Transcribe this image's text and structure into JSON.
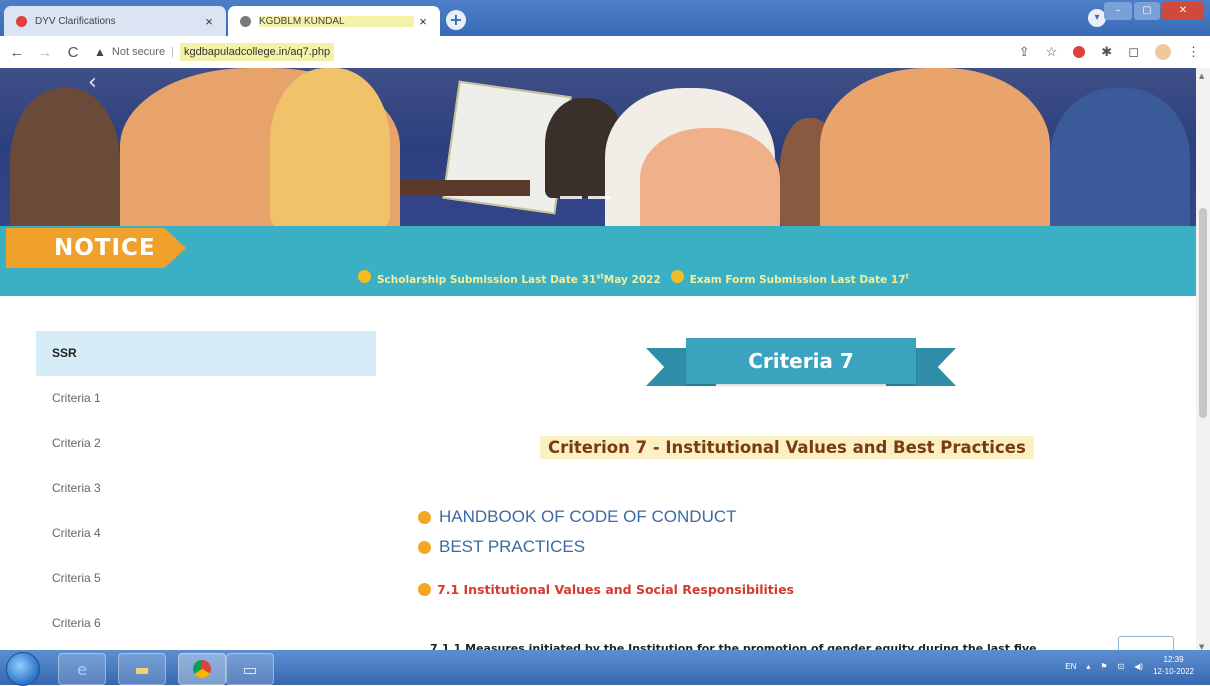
{
  "browser": {
    "tabs": [
      {
        "title": "DYV Clarifications",
        "close": "×"
      },
      {
        "title": "KGDBLM KUNDAL",
        "close": "×"
      }
    ],
    "new_tab": "+",
    "window": {
      "min": "–",
      "max": "▢",
      "close": "✕"
    },
    "nav": {
      "back": "←",
      "forward": "→",
      "reload": "C"
    },
    "security_label": "Not secure",
    "url": "kgdbapuladcollege.in/aq7.php"
  },
  "notice": {
    "tag": "NOTICE",
    "ticker": [
      {
        "text": "Scholarship Submission Last Date 31",
        "sup": "st",
        "tail": "May 2022"
      },
      {
        "text": "Exam Form Submission Last Date 17",
        "sup": "t",
        "tail": ""
      }
    ]
  },
  "sidebar": {
    "items": [
      {
        "label": "SSR",
        "active": true
      },
      {
        "label": "Criteria 1"
      },
      {
        "label": "Criteria 2"
      },
      {
        "label": "Criteria 3"
      },
      {
        "label": "Criteria 4"
      },
      {
        "label": "Criteria 5"
      },
      {
        "label": "Criteria 6"
      }
    ]
  },
  "main": {
    "ribbon_title": "Criteria 7",
    "criterion_heading": "Criterion 7 - Institutional Values and Best Practices",
    "links": [
      "HANDBOOK OF CODE OF CONDUCT",
      "BEST PRACTICES"
    ],
    "sub_heading": "7.1 Institutional Values and Social Responsibilities",
    "measure_text": "7.1.1 Measures initiated by the Institution for the promotion of gender equity during the last five"
  },
  "taskbar": {
    "lang": "EN",
    "time": "12:39",
    "date": "12-10-2022"
  },
  "colors": {
    "tab_bar": "#3a6bb7",
    "notice_band": "#3bafc4",
    "notice_tag": "#f0a12c",
    "ribbon": "#3aa4be",
    "criterion_text": "#7a3a12",
    "sub_heading": "#d83a2c",
    "link_text": "#3b6aa3",
    "sidebar_active": "#d6ecf6"
  }
}
